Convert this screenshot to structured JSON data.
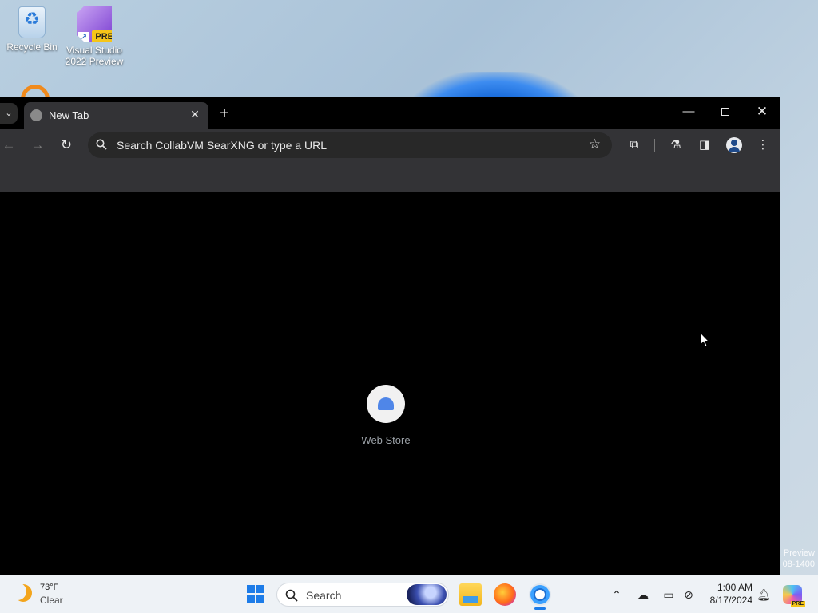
{
  "desktop": {
    "icons": [
      {
        "label": "Recycle Bin"
      },
      {
        "label": "Visual Studio 2022 Preview",
        "badge": "PRE"
      }
    ],
    "watermark": {
      "line1": "Preview",
      "line2": "08-1400"
    }
  },
  "browser": {
    "tabs": [
      {
        "title": "New Tab",
        "active": true
      }
    ],
    "omnibox": {
      "placeholder": "Search CollabVM SearXNG or type a URL"
    },
    "new_tab_page": {
      "shortcuts": [
        {
          "label": "Web Store"
        }
      ]
    }
  },
  "taskbar": {
    "weather": {
      "temp": "73°F",
      "condition": "Clear"
    },
    "search": {
      "label": "Search"
    },
    "apps": [
      "file-explorer",
      "firefox",
      "chrome"
    ],
    "clock": {
      "time": "1:00 AM",
      "date": "8/17/2024"
    },
    "copilot_badge": "PRE"
  },
  "colors": {
    "browser_frame": "#000000",
    "toolbar": "#333336",
    "accent": "#1d7ce8"
  }
}
